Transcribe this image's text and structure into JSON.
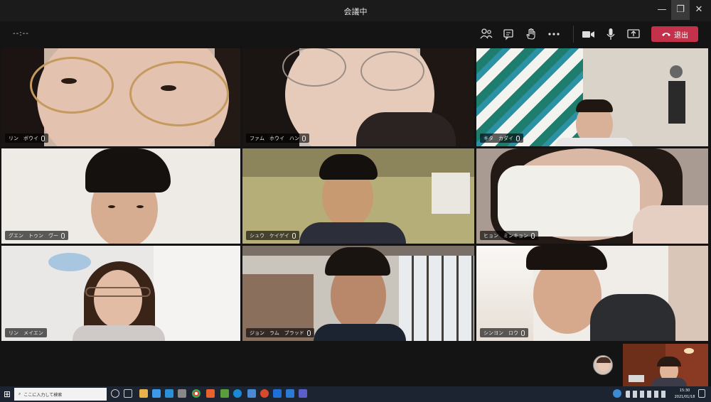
{
  "window": {
    "title": "会議中"
  },
  "meeting": {
    "timer": "--:--",
    "leave_label": "退出",
    "toolbar_icons": [
      "participants-icon",
      "chat-icon",
      "raise-hand-icon",
      "more-actions-icon",
      "camera-icon",
      "microphone-icon",
      "share-screen-icon"
    ]
  },
  "participants": [
    {
      "name": "リン　ボウイ"
    },
    {
      "name": "ファム　ホウイ　ハン"
    },
    {
      "name": "キタ　カダイ"
    },
    {
      "name": "グエン　トゥン　ヴー"
    },
    {
      "name": "シュウ　ケイゲイ"
    },
    {
      "name": "ヒョン　ミンキョン"
    },
    {
      "name": "リン　メイエン"
    },
    {
      "name": "ジョン　ラム　ブラッド"
    },
    {
      "name": "シンヨン　ロウ"
    }
  ],
  "taskbar": {
    "search_placeholder": "ここに入力して検索",
    "time": "15:30",
    "date": "2021/01/18"
  },
  "colors": {
    "leave": "#c4314b",
    "background": "#141414",
    "taskbar": "#1c2431"
  }
}
